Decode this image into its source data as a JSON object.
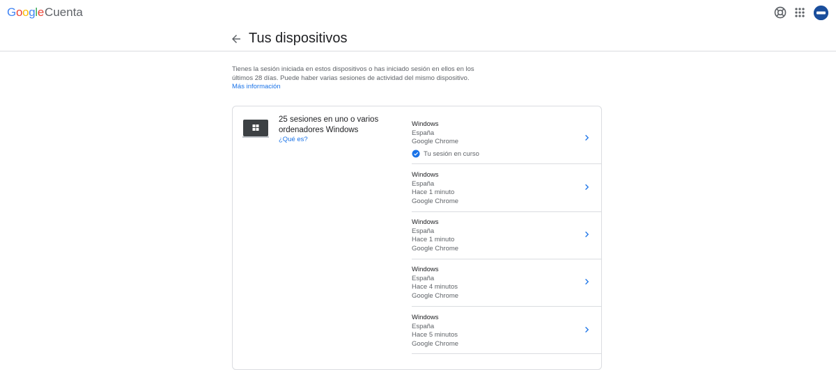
{
  "header": {
    "logo_google": "Google",
    "logo_cuenta": "Cuenta",
    "help_icon": "help-icon",
    "apps_icon": "apps-grid-icon",
    "brand_color": "#1a73e8"
  },
  "page": {
    "title": "Tus dispositivos",
    "intro": "Tienes la sesión iniciada en estos dispositivos o has iniciado sesión en ellos en los últimos 28 días. Puede haber varias sesiones de actividad del mismo dispositivo.",
    "more_info": "Más información"
  },
  "group": {
    "title": "25 sesiones en uno o varios ordenadores Windows",
    "what_link": "¿Qué es?"
  },
  "sessions": [
    {
      "os": "Windows",
      "location": "España",
      "time": "",
      "browser": "Google Chrome",
      "current": "Tu sesión en curso"
    },
    {
      "os": "Windows",
      "location": "España",
      "time": "Hace 1 minuto",
      "browser": "Google Chrome",
      "current": ""
    },
    {
      "os": "Windows",
      "location": "España",
      "time": "Hace 1 minuto",
      "browser": "Google Chrome",
      "current": ""
    },
    {
      "os": "Windows",
      "location": "España",
      "time": "Hace 4 minutos",
      "browser": "Google Chrome",
      "current": ""
    },
    {
      "os": "Windows",
      "location": "España",
      "time": "Hace 5 minutos",
      "browser": "Google Chrome",
      "current": ""
    }
  ]
}
